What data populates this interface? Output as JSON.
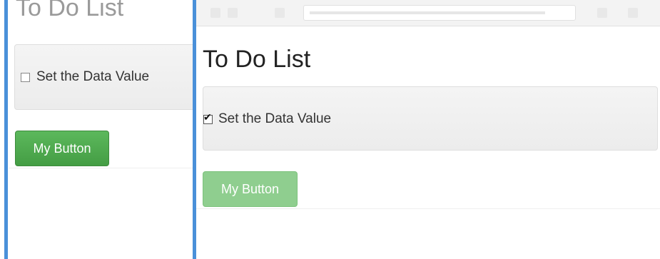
{
  "left_view": {
    "title": "To Do List",
    "item_label": "Set the Data Value",
    "item_checked": false,
    "button_label": "My Button"
  },
  "right_view": {
    "title": "To Do List",
    "item_label": "Set the Data Value",
    "item_checked": true,
    "button_label": "My Button"
  },
  "colors": {
    "accent_blue": "#4a90d9",
    "button_green": "#5cb85c",
    "button_green_disabled": "#8fce8f"
  }
}
